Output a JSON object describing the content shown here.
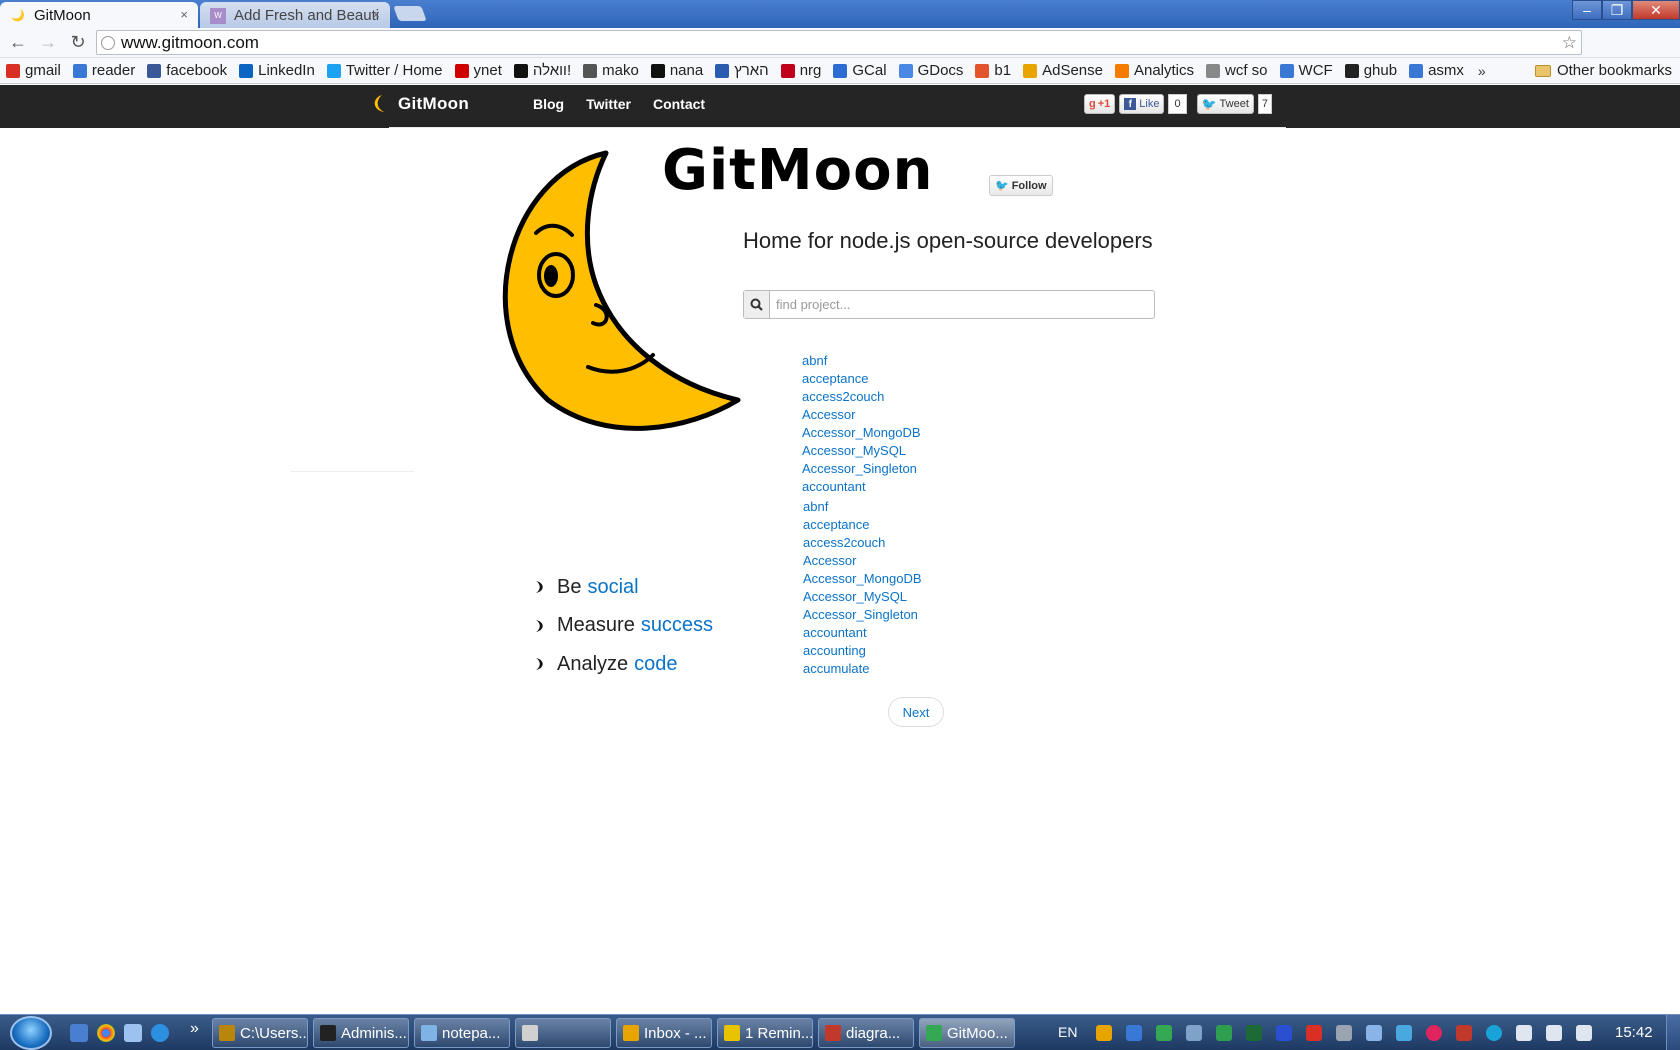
{
  "browser": {
    "tabs": [
      {
        "title": "GitMoon",
        "active": true
      },
      {
        "title": "Add Fresh and Beauti",
        "active": false
      }
    ],
    "address": "www.gitmoon.com",
    "bookmarks": [
      {
        "label": "gmail",
        "icon": "gmail-icon",
        "color": "#d93025"
      },
      {
        "label": "reader",
        "icon": "reader-icon",
        "color": "#3a78d6"
      },
      {
        "label": "facebook",
        "icon": "facebook-icon",
        "color": "#3b5998"
      },
      {
        "label": "LinkedIn",
        "icon": "linkedin-icon",
        "color": "#0a66c2"
      },
      {
        "label": "Twitter / Home",
        "icon": "twitter-icon",
        "color": "#1da1f2"
      },
      {
        "label": "ynet",
        "icon": "ynet-icon",
        "color": "#d10000"
      },
      {
        "label": "וואלה!",
        "icon": "walla-icon",
        "color": "#111111"
      },
      {
        "label": "mako",
        "icon": "mako-icon",
        "color": "#555555"
      },
      {
        "label": "nana",
        "icon": "nana-icon",
        "color": "#111111"
      },
      {
        "label": "הארץ",
        "icon": "haaretz-icon",
        "color": "#2a5db0"
      },
      {
        "label": "nrg",
        "icon": "nrg-icon",
        "color": "#c0001a"
      },
      {
        "label": "GCal",
        "icon": "gcal-icon",
        "color": "#2d6cd3"
      },
      {
        "label": "GDocs",
        "icon": "gdocs-icon",
        "color": "#4b88e6"
      },
      {
        "label": "b1",
        "icon": "b1-icon",
        "color": "#e5532d"
      },
      {
        "label": "AdSense",
        "icon": "adsense-icon",
        "color": "#e8a400"
      },
      {
        "label": "Analytics",
        "icon": "analytics-icon",
        "color": "#f57c00"
      },
      {
        "label": "wcf so",
        "icon": "stackoverflow-icon",
        "color": "#888888"
      },
      {
        "label": "WCF",
        "icon": "wcf-icon",
        "color": "#3a78d6"
      },
      {
        "label": "ghub",
        "icon": "github-icon",
        "color": "#222222"
      },
      {
        "label": "asmx",
        "icon": "asmx-icon",
        "color": "#3a78d6"
      }
    ],
    "bookmarks_more": "»",
    "other_bookmarks": "Other bookmarks"
  },
  "site": {
    "brand": "GitMoon",
    "nav": [
      "Blog",
      "Twitter",
      "Contact"
    ],
    "social": {
      "gplus": "+1",
      "like": "Like",
      "like_count": "0",
      "tweet": "Tweet",
      "tweet_count": "7"
    },
    "logo_text": "GitMoon",
    "follow": "Follow",
    "tagline": "Home for node.js open-source developers",
    "search_placeholder": "find project...",
    "projects_group1": [
      "abnf",
      "acceptance",
      "access2couch",
      "Accessor",
      "Accessor_MongoDB",
      "Accessor_MySQL",
      "Accessor_Singleton",
      "accountant"
    ],
    "projects_group2": [
      "abnf",
      "acceptance",
      "access2couch",
      "Accessor",
      "Accessor_MongoDB",
      "Accessor_MySQL",
      "Accessor_Singleton",
      "accountant",
      "accounting",
      "accumulate"
    ],
    "features": [
      {
        "prefix": "Be",
        "highlight": "social"
      },
      {
        "prefix": "Measure",
        "highlight": "success"
      },
      {
        "prefix": "Analyze",
        "highlight": "code"
      }
    ],
    "next": "Next",
    "link_color": "#0b73c7",
    "moon_color": "#ffbf00"
  },
  "taskbar": {
    "tasks": [
      {
        "label": "C:\\Users...",
        "color": "#b8860b"
      },
      {
        "label": "Adminis...",
        "color": "#222222"
      },
      {
        "label": "notepa...",
        "color": "#7fb2e5"
      },
      {
        "label": "",
        "color": "#d0d0d0"
      },
      {
        "label": "Inbox - ...",
        "color": "#e8a400"
      },
      {
        "label": "1 Remin...",
        "color": "#e8c400"
      },
      {
        "label": "diagra...",
        "color": "#c0392b"
      },
      {
        "label": "GitMoo...",
        "color": "#34a853",
        "active": true
      }
    ],
    "lang": "EN",
    "time": "15:42"
  }
}
